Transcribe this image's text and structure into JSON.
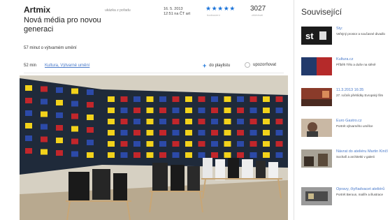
{
  "video": {
    "title": "Artmix",
    "subtitle": "Nová média pro novou generaci",
    "byline": "ukázka z pořadu",
    "date": "16. 5. 2013",
    "time": "12:51 na ČT art",
    "rating_stars": "★★★★★",
    "rating_caption": "hodnocení",
    "views": "3027",
    "views_caption": "zhlédnutí",
    "description": "57 minut o výtvarném umění",
    "duration": "52 min",
    "category": "Kultura, Výtvarné umění",
    "add_playlist": "do playlistu",
    "remind": "upozorňovat"
  },
  "sidebar": {
    "heading": "Související",
    "items": [
      {
        "title": "Sty:",
        "subtitle": "Veřejný prostor a současné divadlo",
        "thumb": "stv"
      },
      {
        "title": "Kultura.cz",
        "subtitle": "Příběh Tělo a duše na stěně",
        "thumb": "blue-red"
      },
      {
        "title": "11.3.2013 16:35",
        "subtitle": "27. ročník přehlídky Evropský film",
        "thumb": "gallery"
      },
      {
        "title": "Euro Gastro.cz",
        "subtitle": "Portrét výtvarného umělce",
        "thumb": "portrait"
      },
      {
        "title": "Návrat do ateliéru Martin Kinčl",
        "subtitle": "Sochaři a architekti v galerii",
        "thumb": "room"
      },
      {
        "title": "Opravy, čtyřiadvacet ateliérů",
        "subtitle": "Portrét Beroun, malíře a illustrace",
        "thumb": "exhibit"
      }
    ]
  },
  "colors": {
    "accent": "#1a73d9",
    "link": "#4a7ac9",
    "wall": "#1f2a3a"
  }
}
